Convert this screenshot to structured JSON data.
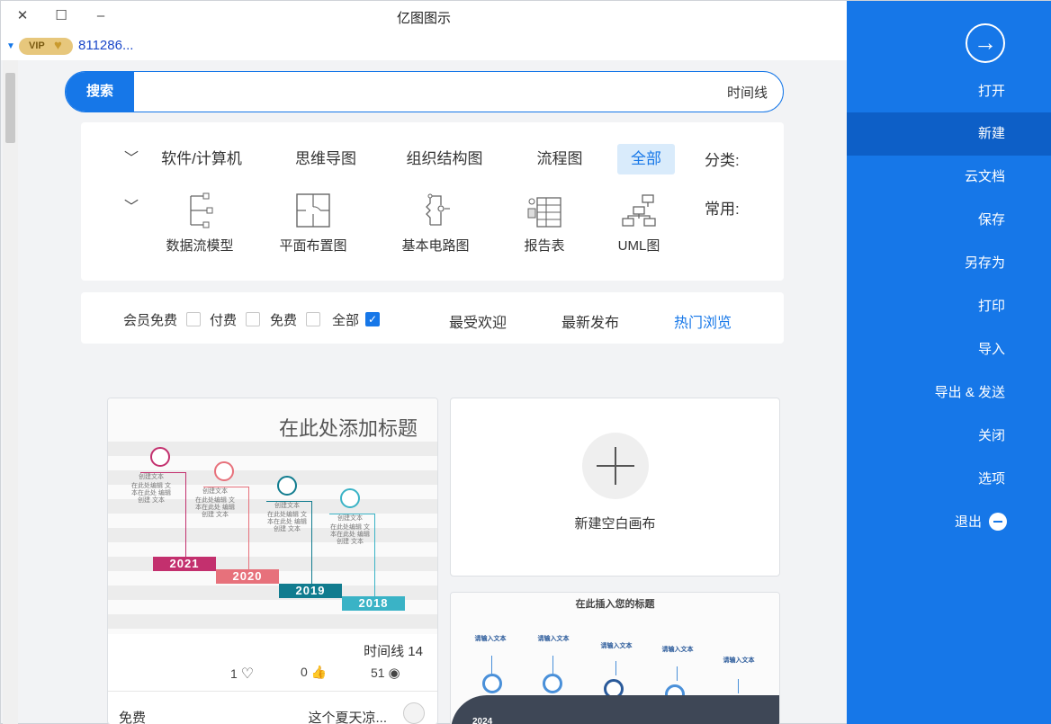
{
  "window": {
    "title": "亿图图示",
    "close_glyph": "✕",
    "maximize_glyph": "☐",
    "minimize_glyph": "–"
  },
  "user": {
    "vip_label": "VIP",
    "user_id": "811286..."
  },
  "search": {
    "button_label": "搜索",
    "query": "时间线"
  },
  "categories": {
    "label": "分类:",
    "items": [
      {
        "label": "全部",
        "active": true
      },
      {
        "label": "流程图",
        "active": false
      },
      {
        "label": "组织结构图",
        "active": false
      },
      {
        "label": "思维导图",
        "active": false
      },
      {
        "label": "软件/计算机",
        "active": false
      }
    ]
  },
  "common": {
    "label": "常用:",
    "items": [
      {
        "label": "UML图",
        "icon": "uml-icon"
      },
      {
        "label": "报告表",
        "icon": "report-icon"
      },
      {
        "label": "基本电路图",
        "icon": "circuit-icon"
      },
      {
        "label": "平面布置图",
        "icon": "floorplan-icon"
      },
      {
        "label": "数据流模型",
        "icon": "dataflow-icon"
      }
    ]
  },
  "sort": {
    "items": [
      {
        "label": "热门浏览",
        "active": true
      },
      {
        "label": "最新发布",
        "active": false
      },
      {
        "label": "最受欢迎",
        "active": false
      }
    ]
  },
  "price_filter": [
    {
      "label": "全部",
      "checked": true
    },
    {
      "label": "免费",
      "checked": false
    },
    {
      "label": "付费",
      "checked": false
    },
    {
      "label": "会员免费",
      "checked": false
    }
  ],
  "new_card": {
    "label": "新建空白画布"
  },
  "template_card": {
    "thumb_title": "在此处添加标题",
    "name": "时间线 14",
    "views": "51",
    "likes": "0",
    "favorites": "1",
    "author": "这个夏天凉...",
    "price": "免费",
    "years": [
      "2018",
      "2019",
      "2020",
      "2021"
    ],
    "node_title": "创建文本",
    "node_text": "在此处编辑 文本在此处 编辑创建 文本"
  },
  "template_card2": {
    "thumb_title": "在此插入您的标题",
    "year": "2024",
    "node_title": "请输入文本"
  },
  "sidebar": {
    "back_glyph": "→",
    "items": [
      {
        "label": "打开",
        "active": false
      },
      {
        "label": "新建",
        "active": true
      },
      {
        "label": "云文档",
        "active": false
      },
      {
        "label": "保存",
        "active": false
      },
      {
        "label": "另存为",
        "active": false
      },
      {
        "label": "打印",
        "active": false
      },
      {
        "label": "导入",
        "active": false
      },
      {
        "label": "导出 & 发送",
        "active": false
      },
      {
        "label": "关闭",
        "active": false
      },
      {
        "label": "选项",
        "active": false
      }
    ],
    "exit_label": "退出"
  },
  "colors": {
    "accent": "#1677e8",
    "sidebar_active": "#0d5fc7",
    "year_2018": "#3ab3c6",
    "year_2019": "#117c8f",
    "year_2020": "#e7717b",
    "year_2021": "#c3306e"
  }
}
